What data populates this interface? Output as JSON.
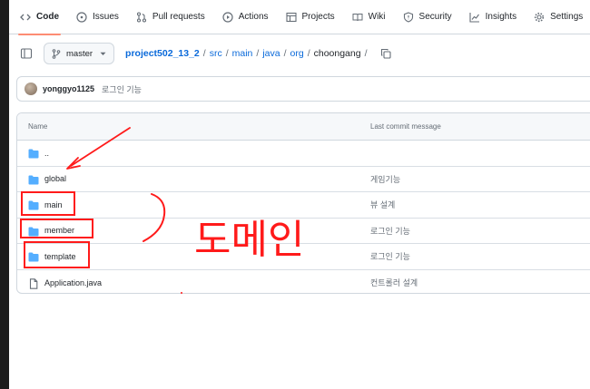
{
  "nav": {
    "items": [
      {
        "label": "Code",
        "icon": "code-icon"
      },
      {
        "label": "Issues",
        "icon": "issue-icon"
      },
      {
        "label": "Pull requests",
        "icon": "pull-request-icon"
      },
      {
        "label": "Actions",
        "icon": "play-icon"
      },
      {
        "label": "Projects",
        "icon": "table-icon"
      },
      {
        "label": "Wiki",
        "icon": "book-icon"
      },
      {
        "label": "Security",
        "icon": "shield-icon"
      },
      {
        "label": "Insights",
        "icon": "graph-icon"
      },
      {
        "label": "Settings",
        "icon": "gear-icon"
      }
    ]
  },
  "branch": {
    "name": "master"
  },
  "breadcrumb": {
    "repo": "project502_13_2",
    "parts": [
      "src",
      "main",
      "java",
      "org"
    ],
    "current": "choongang",
    "trailing": "/"
  },
  "commit": {
    "user": "yonggyo1125",
    "message": "로그인 기능"
  },
  "table": {
    "headers": {
      "name": "Name",
      "last_commit": "Last commit message"
    },
    "rows": [
      {
        "name": "..",
        "message": "",
        "type": "parent"
      },
      {
        "name": "global",
        "message": "게임기능",
        "type": "folder"
      },
      {
        "name": "main",
        "message": "뷰 설계",
        "type": "folder"
      },
      {
        "name": "member",
        "message": "로그인 기능",
        "type": "folder"
      },
      {
        "name": "template",
        "message": "로그인 기능",
        "type": "folder"
      },
      {
        "name": "Application.java",
        "message": "컨트롤러 설계",
        "type": "file"
      }
    ]
  },
  "annotation": {
    "text": "도메인",
    "color": "#ff1a1a"
  },
  "colors": {
    "link": "#0969da",
    "folder": "#54aeff",
    "active_tab_underline": "#fd8c73",
    "border": "#d0d7de"
  }
}
